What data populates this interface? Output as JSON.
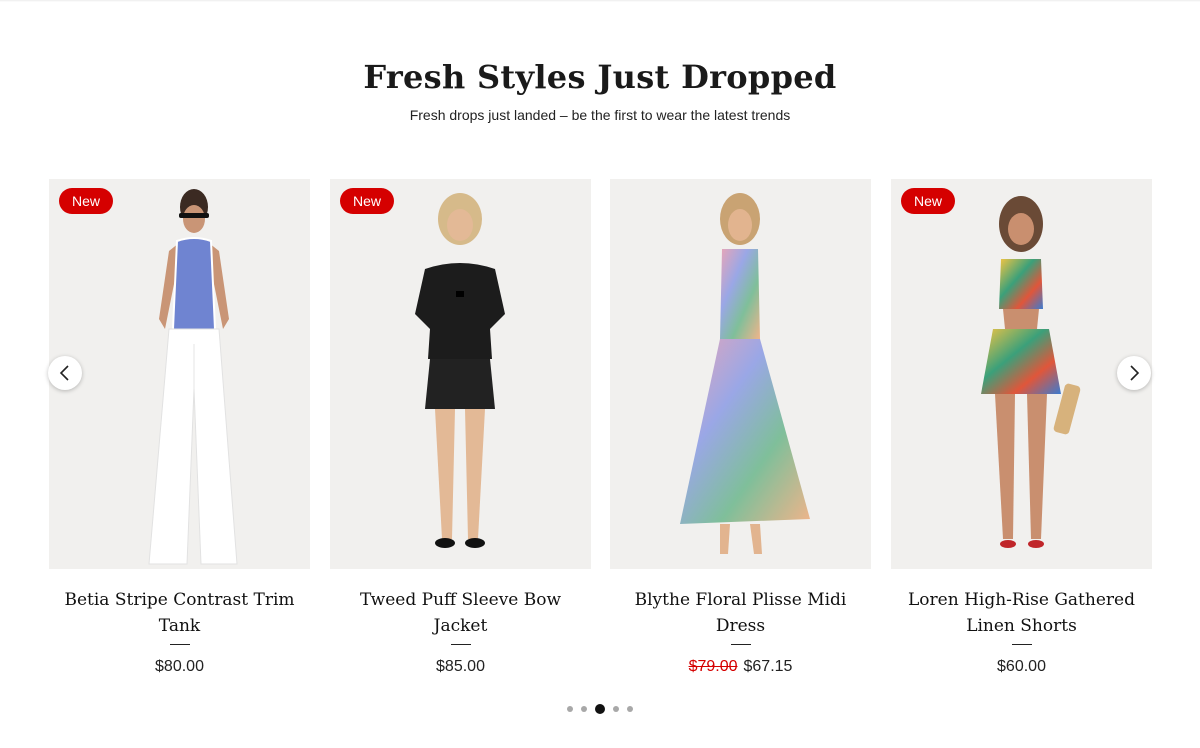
{
  "section": {
    "title": "Fresh Styles Just Dropped",
    "subtitle": "Fresh drops just landed – be the first to wear the latest trends"
  },
  "products": [
    {
      "name": "Betia Stripe Contrast Trim Tank",
      "badge": "New",
      "price": "$80.00",
      "original_price": "",
      "sale_price": ""
    },
    {
      "name": "Tweed Puff Sleeve Bow Jacket",
      "badge": "New",
      "price": "$85.00",
      "original_price": "",
      "sale_price": ""
    },
    {
      "name": "Blythe Floral Plisse Midi Dress",
      "badge": "",
      "price": "",
      "original_price": "$79.00",
      "sale_price": "$67.15"
    },
    {
      "name": "Loren High-Rise Gathered Linen Shorts",
      "badge": "New",
      "price": "$60.00",
      "original_price": "",
      "sale_price": ""
    }
  ],
  "carousel": {
    "prev_icon": "chevron-left-icon",
    "next_icon": "chevron-right-icon",
    "pagination_count": 5,
    "active_page": 3
  },
  "colors": {
    "badge": "#d50000",
    "sale_price": "#d50000",
    "image_bg": "#f1f0ee"
  }
}
